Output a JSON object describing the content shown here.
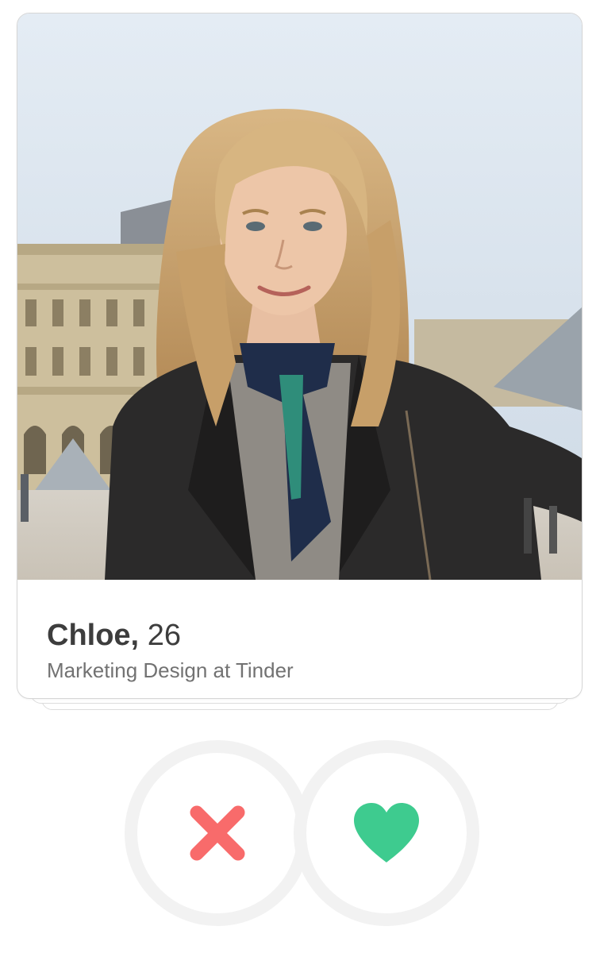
{
  "profile": {
    "name": "Chloe,",
    "age": "26",
    "job": "Marketing Design at Tinder"
  },
  "actions": {
    "nope_icon": "x-icon",
    "like_icon": "heart-icon"
  },
  "colors": {
    "nope": "#f86b6b",
    "like": "#3ecb8f",
    "ring": "#f2f2f2",
    "name_text": "#3d3d3d",
    "job_text": "#727272"
  }
}
